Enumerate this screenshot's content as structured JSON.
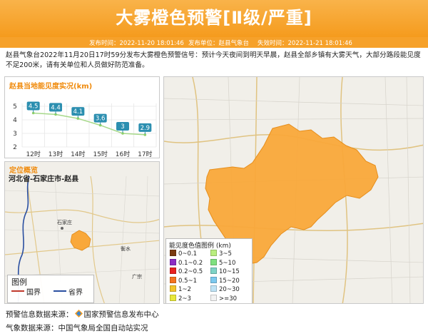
{
  "header": {
    "title": "大雾橙色预警[Ⅱ级/严重]",
    "publish_time": "发布时间：2022-11-20 18:01:46",
    "publisher": "发布单位：赵县气象台",
    "expire_time": "失效时间：2022-11-21 18:01:46"
  },
  "description": "赵县气象台2022年11月20日17时59分发布大雾橙色预警信号：预计今天夜间到明天早晨，赵县全部乡镇有大雾天气，大部分路段能见度不足200米，请有关单位和人员做好防范准备。",
  "visibility_panel": {
    "title": "赵县当地能见度实况(km)"
  },
  "chart_data": {
    "type": "line",
    "title": "赵县当地能见度实况(km)",
    "categories": [
      "12时",
      "13时",
      "14时",
      "15时",
      "16时",
      "17时"
    ],
    "values": [
      4.5,
      4.4,
      4.1,
      3.6,
      3,
      2.9
    ],
    "value_labels": [
      "4.5",
      "4.4",
      "4.1",
      "3.6",
      "3",
      "2.9"
    ],
    "y_ticks": [
      "5",
      "4",
      "3",
      "2"
    ],
    "ylim": [
      2,
      5
    ],
    "grid": true,
    "line_color": "#a7d98a",
    "label_color": "#2c8fb0"
  },
  "location_panel": {
    "title": "定位概览",
    "location": "河北省-石家庄市-赵县",
    "city_label": "石家庄",
    "town_labels": [
      "衡水",
      "广宗"
    ],
    "legend_title": "图例",
    "legend_items": [
      "国界",
      "省界"
    ]
  },
  "visibility_legend": {
    "title": "能见度色值图例 (km)",
    "items": [
      {
        "label": "0~0.1",
        "color": "#7a3b12"
      },
      {
        "label": "3~5",
        "color": "#b9ee7e"
      },
      {
        "label": "0.1~0.2",
        "color": "#8c2cc4"
      },
      {
        "label": "5~10",
        "color": "#7fe07f"
      },
      {
        "label": "0.2~0.5",
        "color": "#e8201f"
      },
      {
        "label": "10~15",
        "color": "#7fd3c6"
      },
      {
        "label": "0.5~1",
        "color": "#f4731f"
      },
      {
        "label": "15~20",
        "color": "#7cc9ee"
      },
      {
        "label": "1~2",
        "color": "#f3c52a"
      },
      {
        "label": "20~30",
        "color": "#bfe3f5"
      },
      {
        "label": "2~3",
        "color": "#e8e83a"
      },
      {
        "label": ">=30",
        "color": "#f2f2f2"
      }
    ]
  },
  "footer": {
    "warning_source_label": "预警信息数据来源：",
    "warning_source": "国家预警信息发布中心",
    "weather_source": "气象数据来源：中国气象局全国自动站实况"
  },
  "colors": {
    "brand_orange": "#f59b1d",
    "warning_area": "#f9a83a",
    "national_border": "#c0392b",
    "provincial_border": "#2a4fa0"
  },
  "icons": {
    "source_logo": "warning-center-logo-icon"
  }
}
